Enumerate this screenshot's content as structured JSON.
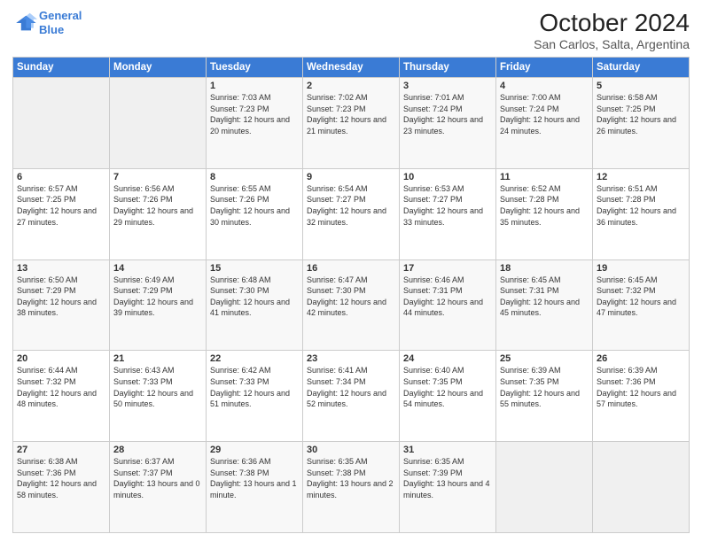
{
  "logo": {
    "line1": "General",
    "line2": "Blue"
  },
  "header": {
    "month": "October 2024",
    "location": "San Carlos, Salta, Argentina"
  },
  "weekdays": [
    "Sunday",
    "Monday",
    "Tuesday",
    "Wednesday",
    "Thursday",
    "Friday",
    "Saturday"
  ],
  "weeks": [
    [
      {
        "day": "",
        "empty": true
      },
      {
        "day": "",
        "empty": true
      },
      {
        "day": "1",
        "sunrise": "Sunrise: 7:03 AM",
        "sunset": "Sunset: 7:23 PM",
        "daylight": "Daylight: 12 hours and 20 minutes."
      },
      {
        "day": "2",
        "sunrise": "Sunrise: 7:02 AM",
        "sunset": "Sunset: 7:23 PM",
        "daylight": "Daylight: 12 hours and 21 minutes."
      },
      {
        "day": "3",
        "sunrise": "Sunrise: 7:01 AM",
        "sunset": "Sunset: 7:24 PM",
        "daylight": "Daylight: 12 hours and 23 minutes."
      },
      {
        "day": "4",
        "sunrise": "Sunrise: 7:00 AM",
        "sunset": "Sunset: 7:24 PM",
        "daylight": "Daylight: 12 hours and 24 minutes."
      },
      {
        "day": "5",
        "sunrise": "Sunrise: 6:58 AM",
        "sunset": "Sunset: 7:25 PM",
        "daylight": "Daylight: 12 hours and 26 minutes."
      }
    ],
    [
      {
        "day": "6",
        "sunrise": "Sunrise: 6:57 AM",
        "sunset": "Sunset: 7:25 PM",
        "daylight": "Daylight: 12 hours and 27 minutes."
      },
      {
        "day": "7",
        "sunrise": "Sunrise: 6:56 AM",
        "sunset": "Sunset: 7:26 PM",
        "daylight": "Daylight: 12 hours and 29 minutes."
      },
      {
        "day": "8",
        "sunrise": "Sunrise: 6:55 AM",
        "sunset": "Sunset: 7:26 PM",
        "daylight": "Daylight: 12 hours and 30 minutes."
      },
      {
        "day": "9",
        "sunrise": "Sunrise: 6:54 AM",
        "sunset": "Sunset: 7:27 PM",
        "daylight": "Daylight: 12 hours and 32 minutes."
      },
      {
        "day": "10",
        "sunrise": "Sunrise: 6:53 AM",
        "sunset": "Sunset: 7:27 PM",
        "daylight": "Daylight: 12 hours and 33 minutes."
      },
      {
        "day": "11",
        "sunrise": "Sunrise: 6:52 AM",
        "sunset": "Sunset: 7:28 PM",
        "daylight": "Daylight: 12 hours and 35 minutes."
      },
      {
        "day": "12",
        "sunrise": "Sunrise: 6:51 AM",
        "sunset": "Sunset: 7:28 PM",
        "daylight": "Daylight: 12 hours and 36 minutes."
      }
    ],
    [
      {
        "day": "13",
        "sunrise": "Sunrise: 6:50 AM",
        "sunset": "Sunset: 7:29 PM",
        "daylight": "Daylight: 12 hours and 38 minutes."
      },
      {
        "day": "14",
        "sunrise": "Sunrise: 6:49 AM",
        "sunset": "Sunset: 7:29 PM",
        "daylight": "Daylight: 12 hours and 39 minutes."
      },
      {
        "day": "15",
        "sunrise": "Sunrise: 6:48 AM",
        "sunset": "Sunset: 7:30 PM",
        "daylight": "Daylight: 12 hours and 41 minutes."
      },
      {
        "day": "16",
        "sunrise": "Sunrise: 6:47 AM",
        "sunset": "Sunset: 7:30 PM",
        "daylight": "Daylight: 12 hours and 42 minutes."
      },
      {
        "day": "17",
        "sunrise": "Sunrise: 6:46 AM",
        "sunset": "Sunset: 7:31 PM",
        "daylight": "Daylight: 12 hours and 44 minutes."
      },
      {
        "day": "18",
        "sunrise": "Sunrise: 6:45 AM",
        "sunset": "Sunset: 7:31 PM",
        "daylight": "Daylight: 12 hours and 45 minutes."
      },
      {
        "day": "19",
        "sunrise": "Sunrise: 6:45 AM",
        "sunset": "Sunset: 7:32 PM",
        "daylight": "Daylight: 12 hours and 47 minutes."
      }
    ],
    [
      {
        "day": "20",
        "sunrise": "Sunrise: 6:44 AM",
        "sunset": "Sunset: 7:32 PM",
        "daylight": "Daylight: 12 hours and 48 minutes."
      },
      {
        "day": "21",
        "sunrise": "Sunrise: 6:43 AM",
        "sunset": "Sunset: 7:33 PM",
        "daylight": "Daylight: 12 hours and 50 minutes."
      },
      {
        "day": "22",
        "sunrise": "Sunrise: 6:42 AM",
        "sunset": "Sunset: 7:33 PM",
        "daylight": "Daylight: 12 hours and 51 minutes."
      },
      {
        "day": "23",
        "sunrise": "Sunrise: 6:41 AM",
        "sunset": "Sunset: 7:34 PM",
        "daylight": "Daylight: 12 hours and 52 minutes."
      },
      {
        "day": "24",
        "sunrise": "Sunrise: 6:40 AM",
        "sunset": "Sunset: 7:35 PM",
        "daylight": "Daylight: 12 hours and 54 minutes."
      },
      {
        "day": "25",
        "sunrise": "Sunrise: 6:39 AM",
        "sunset": "Sunset: 7:35 PM",
        "daylight": "Daylight: 12 hours and 55 minutes."
      },
      {
        "day": "26",
        "sunrise": "Sunrise: 6:39 AM",
        "sunset": "Sunset: 7:36 PM",
        "daylight": "Daylight: 12 hours and 57 minutes."
      }
    ],
    [
      {
        "day": "27",
        "sunrise": "Sunrise: 6:38 AM",
        "sunset": "Sunset: 7:36 PM",
        "daylight": "Daylight: 12 hours and 58 minutes."
      },
      {
        "day": "28",
        "sunrise": "Sunrise: 6:37 AM",
        "sunset": "Sunset: 7:37 PM",
        "daylight": "Daylight: 13 hours and 0 minutes."
      },
      {
        "day": "29",
        "sunrise": "Sunrise: 6:36 AM",
        "sunset": "Sunset: 7:38 PM",
        "daylight": "Daylight: 13 hours and 1 minute."
      },
      {
        "day": "30",
        "sunrise": "Sunrise: 6:35 AM",
        "sunset": "Sunset: 7:38 PM",
        "daylight": "Daylight: 13 hours and 2 minutes."
      },
      {
        "day": "31",
        "sunrise": "Sunrise: 6:35 AM",
        "sunset": "Sunset: 7:39 PM",
        "daylight": "Daylight: 13 hours and 4 minutes."
      },
      {
        "day": "",
        "empty": true
      },
      {
        "day": "",
        "empty": true
      }
    ]
  ]
}
